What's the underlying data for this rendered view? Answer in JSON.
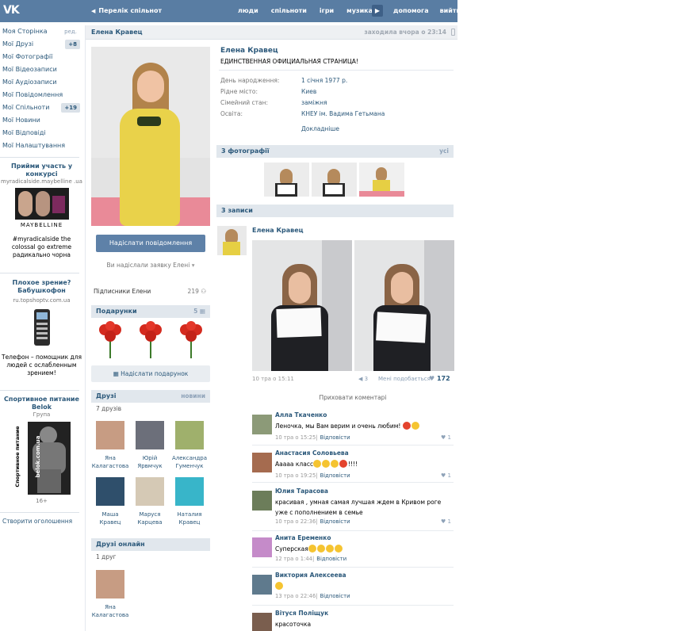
{
  "header": {
    "logo": "VK",
    "breadcrumb": "Перелік спільнот",
    "nav": [
      "люди",
      "спільноти",
      "ігри",
      "музика"
    ],
    "nav2": [
      "допомога",
      "вийти"
    ]
  },
  "left_menu": {
    "items": [
      {
        "label": "Моя Сторінка",
        "side": "ред."
      },
      {
        "label": "Мої Друзі",
        "count": "+8"
      },
      {
        "label": "Мої Фотографії"
      },
      {
        "label": "Мої Відеозаписи"
      },
      {
        "label": "Мої Аудіозаписи"
      },
      {
        "label": "Мої Повідомлення"
      },
      {
        "label": "Мої Спільноти",
        "count": "+19"
      },
      {
        "label": "Мої Новини"
      },
      {
        "label": "Мої Відповіді"
      },
      {
        "label": "Мої Налаштування"
      }
    ],
    "ads": [
      {
        "title": "Прийми участь у конкурсі",
        "url": "myradicalside.maybelline .ua",
        "brand": "MAYBELLINE",
        "text": "#myradicalside the colossal go extreme радикально чорна"
      },
      {
        "title": "Плохое зрение? Бабушкофон",
        "url": "ru.topshoptv.com.ua",
        "text": "Телефон – помощник для людей с ослабленным зрением!"
      },
      {
        "title": "Спортивное питание Belok",
        "url": "Група",
        "side_text": "Спортивное питание",
        "brand": "belok.com.ua",
        "age": "16+"
      }
    ],
    "create_ad": "Створити оголошення"
  },
  "profile": {
    "name": "Елена Кравец",
    "last_seen": "заходила вчора о 23:14",
    "status": "ЕДИНСТВЕННАЯ ОФИЦИАЛЬНАЯ СТРАНИЦА!",
    "info": [
      {
        "label": "День народження:",
        "value": "1 січня 1977 р."
      },
      {
        "label": "Рідне місто:",
        "value": "Киев"
      },
      {
        "label": "Сімейний стан:",
        "value": "заміжня"
      },
      {
        "label": "Освіта:",
        "value": "КНЕУ ім. Вадима Гетьмана"
      }
    ],
    "more": "Докладніше",
    "send_message": "Надіслати повідомлення",
    "request_sent": "Ви надіслали заявку Елені",
    "subscribers_label": "Підписники Елени",
    "subscribers_count": "219"
  },
  "gifts": {
    "title": "Подарунки",
    "count": "5",
    "button": "Надіслати подарунок"
  },
  "friends": {
    "title": "Друзі",
    "link": "новини",
    "count": "7 друзів",
    "list": [
      {
        "first": "Яна",
        "last": "Калагастова"
      },
      {
        "first": "Юрій",
        "last": "Ярвмчук"
      },
      {
        "first": "Александра",
        "last": "Гуменчук"
      },
      {
        "first": "Маша",
        "last": "Кравец"
      },
      {
        "first": "Маруся",
        "last": "Карцева"
      },
      {
        "first": "Наталия",
        "last": "Кравец"
      }
    ]
  },
  "friends_online": {
    "title": "Друзі онлайн",
    "count": "1 друг",
    "list": [
      {
        "first": "Яна",
        "last": "Калагастова"
      }
    ]
  },
  "photos": {
    "title": "3 фотографії",
    "link": "усі"
  },
  "wall": {
    "title": "3 записи",
    "post": {
      "author": "Елена Кравец",
      "time": "10 тра о 15:11",
      "reposts": "3",
      "likes_label": "Мені подобається",
      "likes": "172"
    },
    "hide_comments": "Приховати коментарі",
    "reply_label": "Відповісти",
    "comments": [
      {
        "name": "Алла Ткаченко",
        "text": "Леночка, мы Вам верим и очень любим!",
        "time": "10 тра о 15:25",
        "likes": "1"
      },
      {
        "name": "Анастасия Соловьева",
        "text": "Ааааа класс",
        "suffix": "!!!!",
        "time": "10 тра о 19:25",
        "likes": "1"
      },
      {
        "name": "Юлия Тарасова",
        "text": "красивая , умная самая лучшая ждем в Кривом роге уже с пополнением в семье",
        "time": "10 тра о 22:36",
        "likes": "1"
      },
      {
        "name": "Анита Еременко",
        "text": "Суперская",
        "time": "12 тра о 1:44"
      },
      {
        "name": "Виктория Алексеева",
        "text": "",
        "time": "13 тра о 22:46"
      },
      {
        "name": "Вітуся Поліщук",
        "text": "красоточка"
      }
    ]
  }
}
